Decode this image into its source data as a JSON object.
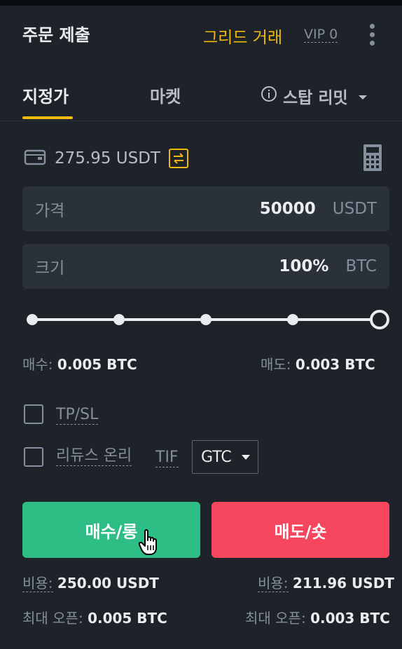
{
  "header": {
    "title": "주문 제출",
    "grid_link": "그리드 거래",
    "vip": "VIP 0"
  },
  "tabs": {
    "limit": "지정가",
    "market": "마켓",
    "stop": "스탑 리밋"
  },
  "balance": {
    "amount": "275.95 USDT"
  },
  "price": {
    "label": "가격",
    "value": "50000",
    "unit": "USDT"
  },
  "size": {
    "label": "크기",
    "value": "100%",
    "unit": "BTC"
  },
  "slider": {
    "value_percent": 100,
    "marks_percent": [
      0,
      25,
      50,
      75,
      100
    ]
  },
  "summary": {
    "buy_label": "매수:",
    "buy_value": "0.005 BTC",
    "sell_label": "매도:",
    "sell_value": "0.003 BTC"
  },
  "options": {
    "tpsl": "TP/SL",
    "reduce_only": "리듀스 온리",
    "tif_label": "TIF",
    "tif_value": "GTC"
  },
  "buttons": {
    "buy": "매수/롱",
    "sell": "매도/숏"
  },
  "footer": {
    "buy_cost_label": "비용:",
    "buy_cost_value": "250.00 USDT",
    "sell_cost_label": "비용:",
    "sell_cost_value": "211.96 USDT",
    "buy_max_label": "최대 오픈:",
    "buy_max_value": "0.005 BTC",
    "sell_max_label": "최대 오픈:",
    "sell_max_value": "0.003 BTC"
  },
  "colors": {
    "accent": "#f0b90b",
    "buy": "#2ebd85",
    "sell": "#f6465d",
    "background": "#1e2329",
    "field": "#2b3139"
  },
  "icons": [
    "kebab-menu-icon",
    "info-icon",
    "chevron-down-icon",
    "wallet-icon",
    "swap-icon",
    "calculator-icon",
    "hand-cursor-icon"
  ]
}
